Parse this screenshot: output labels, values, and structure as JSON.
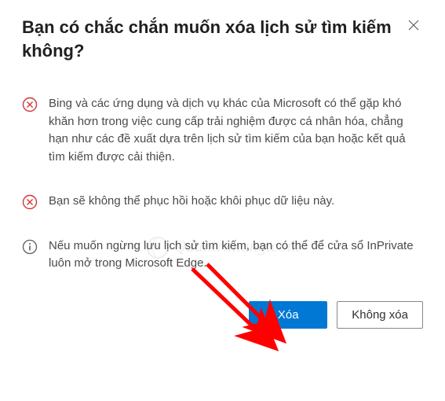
{
  "dialog": {
    "title": "Bạn có chắc chắn muốn xóa lịch sử tìm kiếm không?",
    "items": [
      "Bing và các ứng dụng và dịch vụ khác của Microsoft có thể gặp khó khăn hơn trong việc cung cấp trải nghiệm được cá nhân hóa, chẳng hạn như các đề xuất dựa trên lịch sử tìm kiếm của bạn hoặc kết quả tìm kiếm được cải thiện.",
      "Bạn sẽ không thể phục hồi hoặc khôi phục dữ liệu này.",
      "Nếu muốn ngừng lưu lịch sử tìm kiếm, bạn có thể để cửa sổ InPrivate luôn mở trong Microsoft Edge."
    ],
    "buttons": {
      "confirm": "Xóa",
      "cancel": "Không xóa"
    }
  },
  "colors": {
    "error": "#d13438",
    "info": "#605e5c",
    "primary": "#0078d4"
  },
  "watermark": "Quantrimang.com"
}
